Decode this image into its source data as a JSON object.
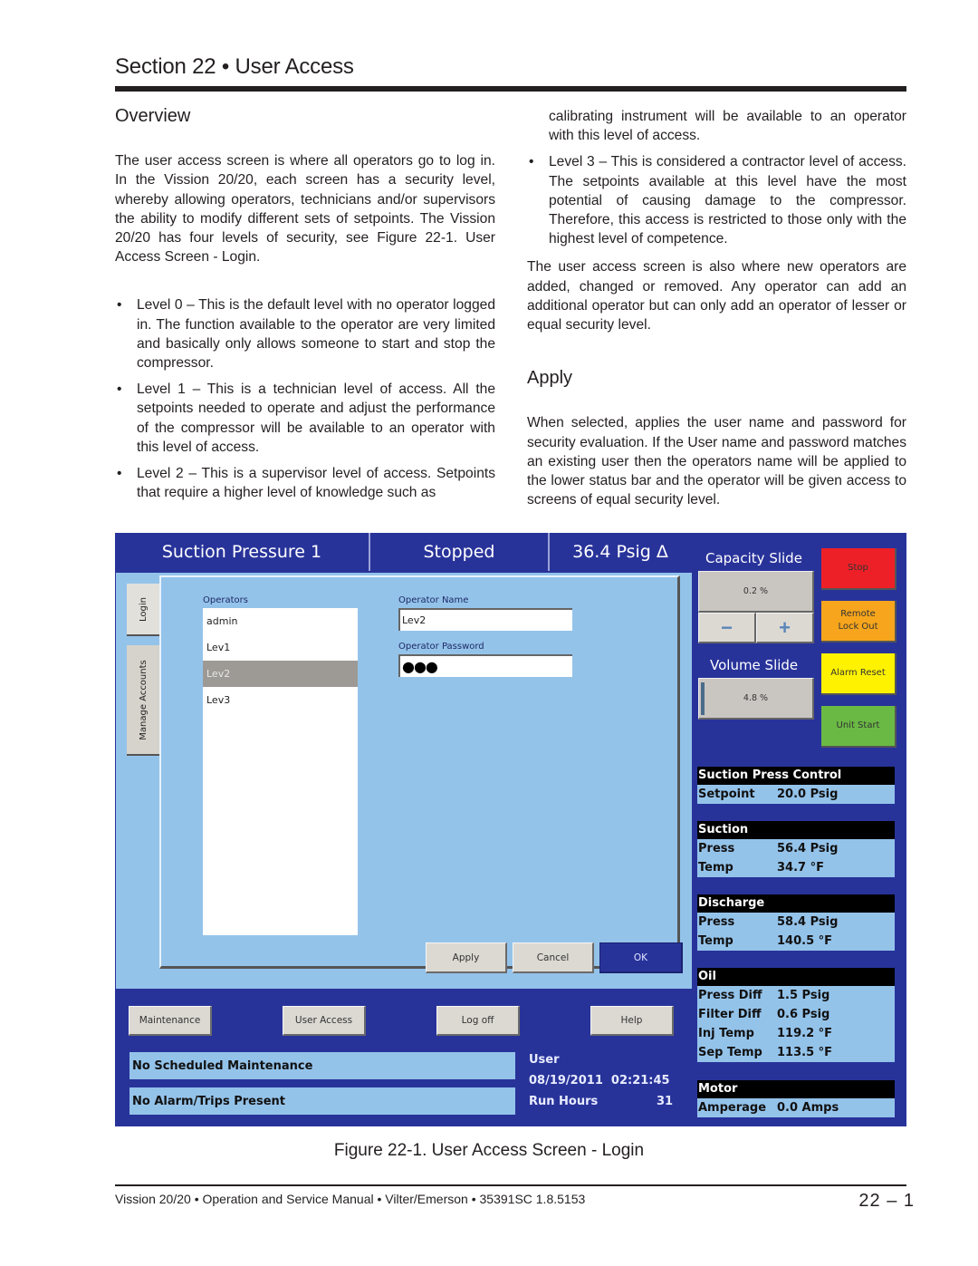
{
  "page": {
    "section_title": "Section 22 • User Access",
    "overview": {
      "heading": "Overview",
      "intro": "The user access screen is where all operators go to log in. In the Vission 20/20, each screen has a security level, whereby allowing operators, technicians and/or supervisors  the ability to modify different sets of setpoints. The Vission 20/20 has four levels of security, see Figure 22-1. User Access Screen - Login.",
      "bullets": [
        "Level 0 – This is the default level with no operator logged in. The function available to the operator are very limited and basically only allows someone to start and stop the compressor.",
        "Level 1 – This is a technician level of access. All the setpoints needed to operate and adjust the performance of the compressor will be available to an operator with this level of access.",
        "Level 2 – This is a supervisor level of access. Setpoints that require a higher level of knowledge such as"
      ],
      "bullet2_continued": "calibrating instrument will be available to an operator with this level of access.",
      "bullet3": "Level 3 – This is considered a contractor level of access. The setpoints available at this level have the most potential of causing damage to the compressor. Therefore, this access is restricted to those only with the highest level of competence.",
      "closing": "The user access screen is also where new operators are added, changed or removed. Any operator can add an additional operator but can only add an operator of lesser or equal security level."
    },
    "apply": {
      "heading": "Apply",
      "body": "When selected, applies the user name and password for security evaluation. If the User name and password matches an existing user then the operators name will be applied to the lower status bar and the operator will be given access to screens of equal security level."
    },
    "figure_caption": "Figure 22-1. User Access Screen - Login",
    "footer": "Vission 20/20 • Operation and Service Manual • Vilter/Emerson • 35391SC 1.8.5153",
    "page_number": "22 – 1"
  },
  "hmi": {
    "header": {
      "control_mode": "Suction Pressure 1",
      "status": "Stopped",
      "value": "36.4 Psig Δ"
    },
    "tabs": [
      "Login",
      "Manage Accounts"
    ],
    "operators_label": "Operators",
    "operators": [
      "admin",
      "Lev1",
      "Lev2",
      "Lev3"
    ],
    "selected_operator": "Lev2",
    "operator_name_label": "Operator Name",
    "operator_name_value": "Lev2",
    "operator_password_label": "Operator Password",
    "operator_password_value": "●●●",
    "dialog_buttons": {
      "apply": "Apply",
      "cancel": "Cancel",
      "ok": "OK"
    },
    "capacity_slide": {
      "label": "Capacity Slide",
      "value": "0.2 %",
      "minus": "−",
      "plus": "+"
    },
    "volume_slide": {
      "label": "Volume Slide",
      "value": "4.8 %"
    },
    "control_buttons": [
      {
        "label": "Stop",
        "color": "#ee2027"
      },
      {
        "label": "Remote Lock Out",
        "color": "#f7a51c"
      },
      {
        "label": "Alarm Reset",
        "color": "#fff200"
      },
      {
        "label": "Unit Start",
        "color": "#6ab944"
      }
    ],
    "info_blocks": [
      {
        "title": "Suction Press Control",
        "rows": [
          {
            "k": "Setpoint",
            "v": "20.0 Psig"
          }
        ]
      },
      {
        "title": "Suction",
        "rows": [
          {
            "k": "Press",
            "v": "56.4 Psig"
          },
          {
            "k": "Temp",
            "v": "34.7 °F"
          }
        ]
      },
      {
        "title": "Discharge",
        "rows": [
          {
            "k": "Press",
            "v": "58.4 Psig"
          },
          {
            "k": "Temp",
            "v": "140.5 °F"
          }
        ]
      },
      {
        "title": "Oil",
        "rows": [
          {
            "k": "Press Diff",
            "v": "1.5 Psig"
          },
          {
            "k": "Filter Diff",
            "v": "0.6 Psig"
          },
          {
            "k": "Inj Temp",
            "v": "119.2 °F"
          },
          {
            "k": "Sep Temp",
            "v": "113.5 °F"
          }
        ]
      },
      {
        "title": "Motor",
        "rows": [
          {
            "k": "Amperage",
            "v": "0.0 Amps"
          }
        ]
      }
    ],
    "nav_buttons": [
      "Maintenance",
      "User Access",
      "Log off",
      "Help"
    ],
    "maintenance_status": "No Scheduled Maintenance",
    "alarm_status": "No Alarm/Trips Present",
    "user_label": "User",
    "datetime": "08/19/2011  02:21:45",
    "run_hours_label": "Run Hours",
    "run_hours_value": "31"
  }
}
